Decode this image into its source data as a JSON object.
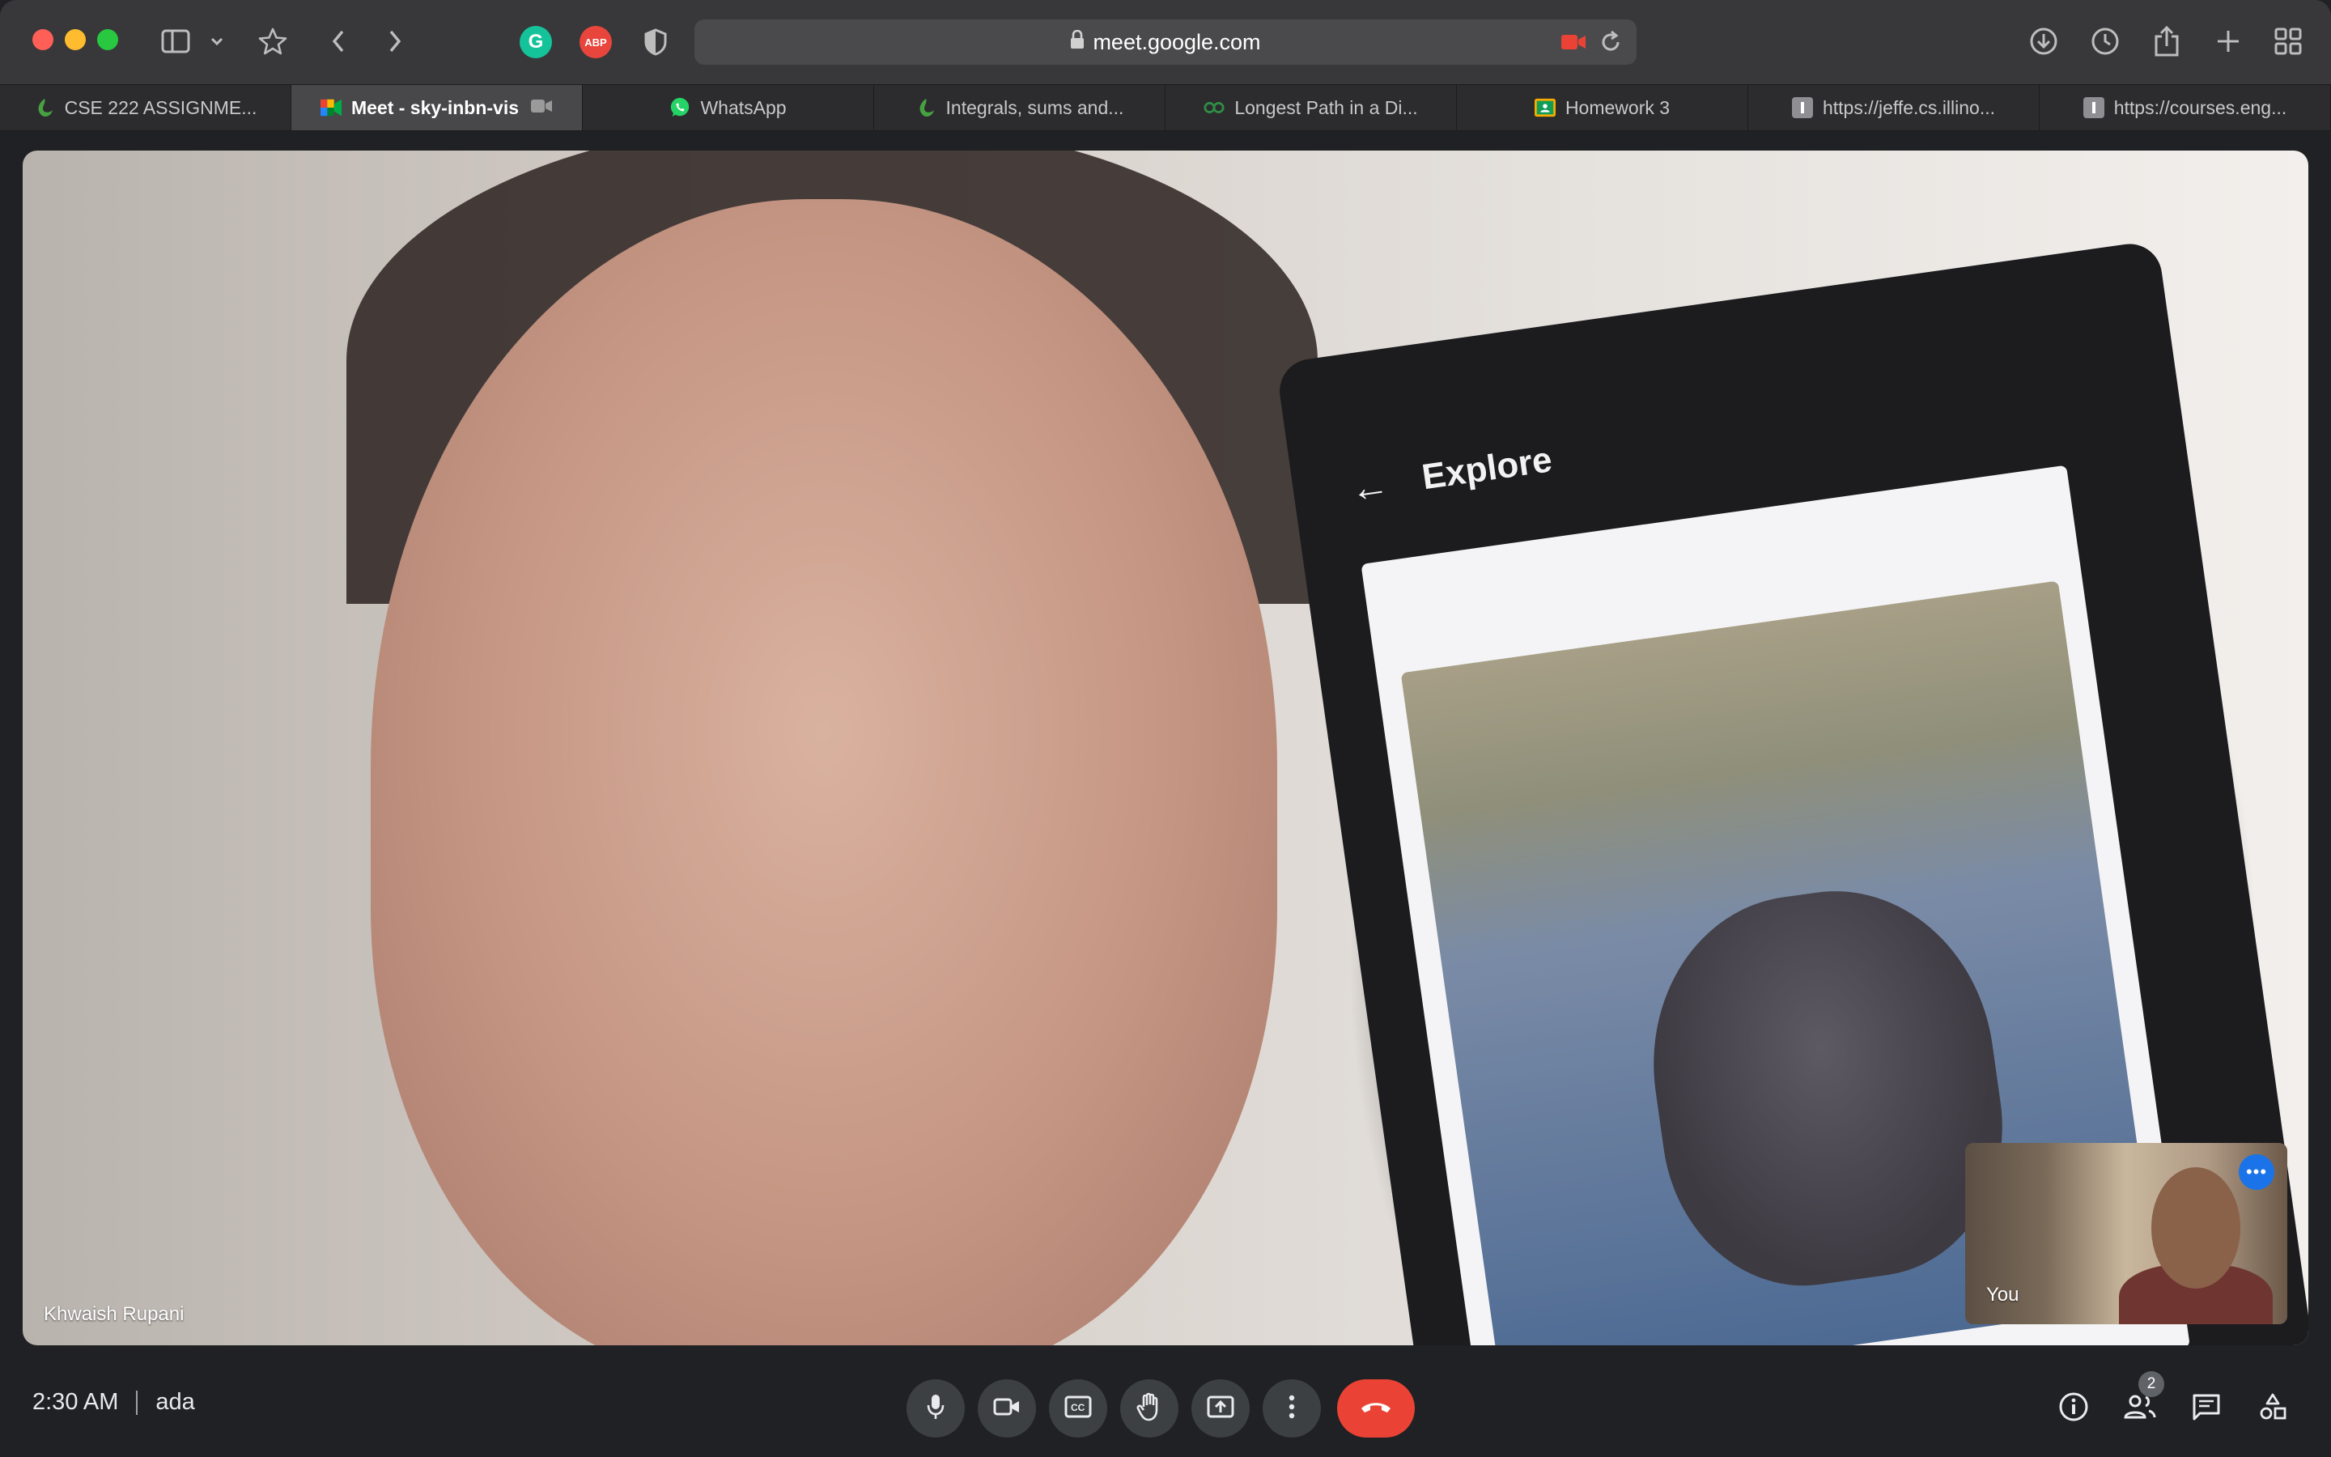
{
  "browser": {
    "url": "meet.google.com",
    "extensions": [
      {
        "name": "grammarly-icon",
        "label": "G"
      },
      {
        "name": "adblock-icon",
        "label": "ABP"
      },
      {
        "name": "privacy-shield-icon",
        "label": ""
      }
    ],
    "tabs": [
      {
        "label": "CSE 222 ASSIGNME...",
        "icon": "overleaf-icon",
        "active": false
      },
      {
        "label": "Meet - sky-inbn-vis",
        "icon": "google-meet-icon",
        "active": true
      },
      {
        "label": "WhatsApp",
        "icon": "whatsapp-icon",
        "active": false
      },
      {
        "label": "Integrals, sums and...",
        "icon": "overleaf-icon",
        "active": false
      },
      {
        "label": "Longest Path in a Di...",
        "icon": "geeksforgeeks-icon",
        "active": false
      },
      {
        "label": "Homework 3",
        "icon": "google-classroom-icon",
        "active": false
      },
      {
        "label": "https://jeffe.cs.illino...",
        "icon": "letter-i-icon",
        "active": false
      },
      {
        "label": "https://courses.eng...",
        "icon": "letter-i-icon",
        "active": false
      }
    ]
  },
  "meeting": {
    "main_participant": "Khwaish Rupani",
    "self_label": "You",
    "time": "2:30 AM",
    "code": "ada",
    "participant_count": "2",
    "phone_screen": {
      "title": "Explore"
    }
  },
  "colors": {
    "end_call": "#ea4335",
    "control_bg": "#3c4043",
    "accent_blue": "#1a73e8"
  }
}
